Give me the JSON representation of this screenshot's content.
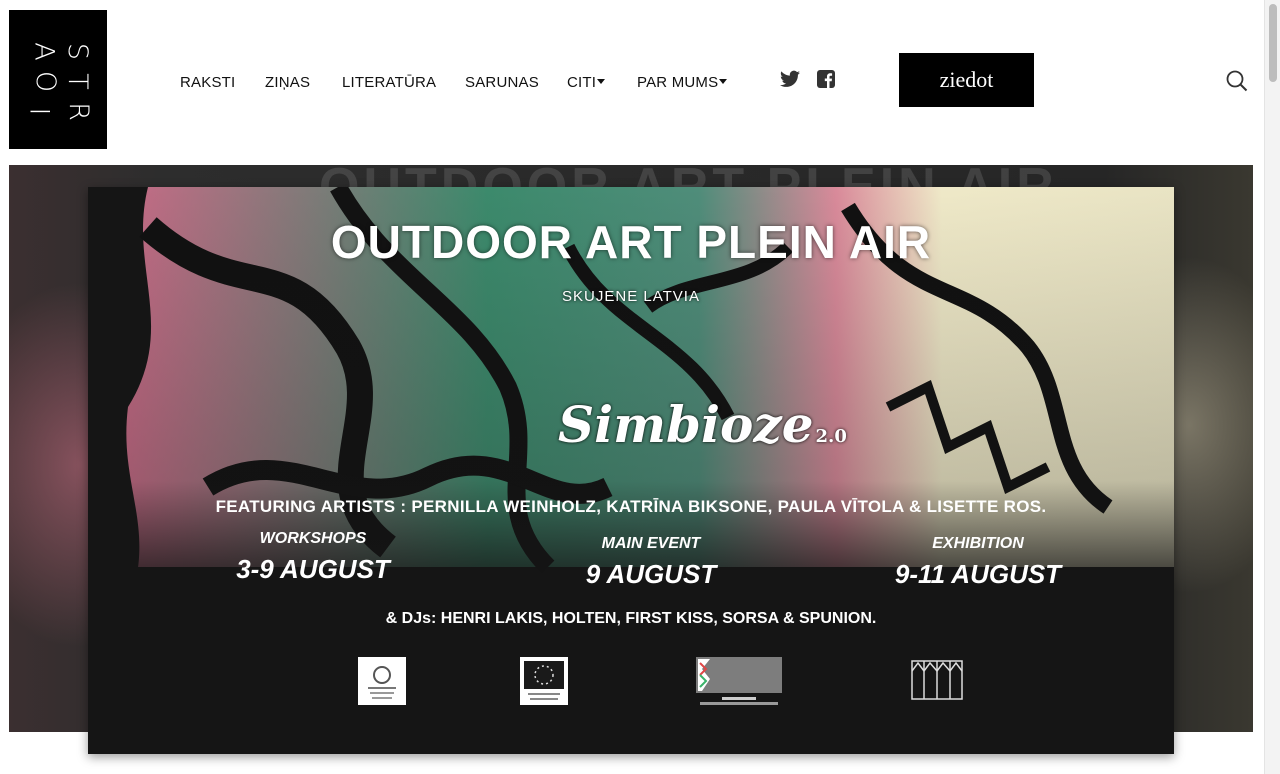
{
  "logo": {
    "letters": [
      "S",
      "T",
      "A",
      "O",
      "R",
      "I"
    ]
  },
  "nav": {
    "items": [
      {
        "label": "RAKSTI",
        "dropdown": false
      },
      {
        "label": "ZIŅAS",
        "dropdown": false
      },
      {
        "label": "LITERATŪRA",
        "dropdown": false
      },
      {
        "label": "SARUNAS",
        "dropdown": false
      },
      {
        "label": "CITI",
        "dropdown": true
      },
      {
        "label": "PAR MUMS",
        "dropdown": true
      }
    ]
  },
  "social": {
    "icons": [
      "twitter-icon",
      "facebook-icon"
    ]
  },
  "donate": {
    "label": "ziedot"
  },
  "search": {
    "icon": "search-icon"
  },
  "poster": {
    "title": "OUTDOOR ART PLEIN AIR",
    "subtitle": "SKUJENE LATVIA",
    "logo_text": "Simbioze",
    "logo_version": "2.0",
    "featuring": "FEATURING ARTISTS :  PERNILLA WEINHOLZ, KATRĪNA BIKSONE, PAULA VĪTOLA  & LISETTE ROS.",
    "events": [
      {
        "label": "WORKSHOPS",
        "date": "3-9 AUGUST"
      },
      {
        "label": "MAIN EVENT",
        "date": "9 AUGUST"
      },
      {
        "label": "EXHIBITION",
        "date": "9-11 AUGUST"
      }
    ],
    "djs": "& DJs: HENRI LAKIS, HOLTEN, FIRST KISS,  SORSA & SPUNION.",
    "sponsors": [
      {
        "name": "agency-emblem",
        "text": "Agency for International Programs for Youth Republic of Latvia"
      },
      {
        "name": "eu-flag",
        "text": "Funded by the European Union"
      },
      {
        "name": "vkkf-logo",
        "text": "STATE CULTURE CAPITAL FOUNDATION"
      },
      {
        "name": "house-logo",
        "text": ""
      }
    ]
  },
  "colors": {
    "accent": "#000000",
    "background": "#ffffff",
    "poster_bg": "#151515"
  }
}
